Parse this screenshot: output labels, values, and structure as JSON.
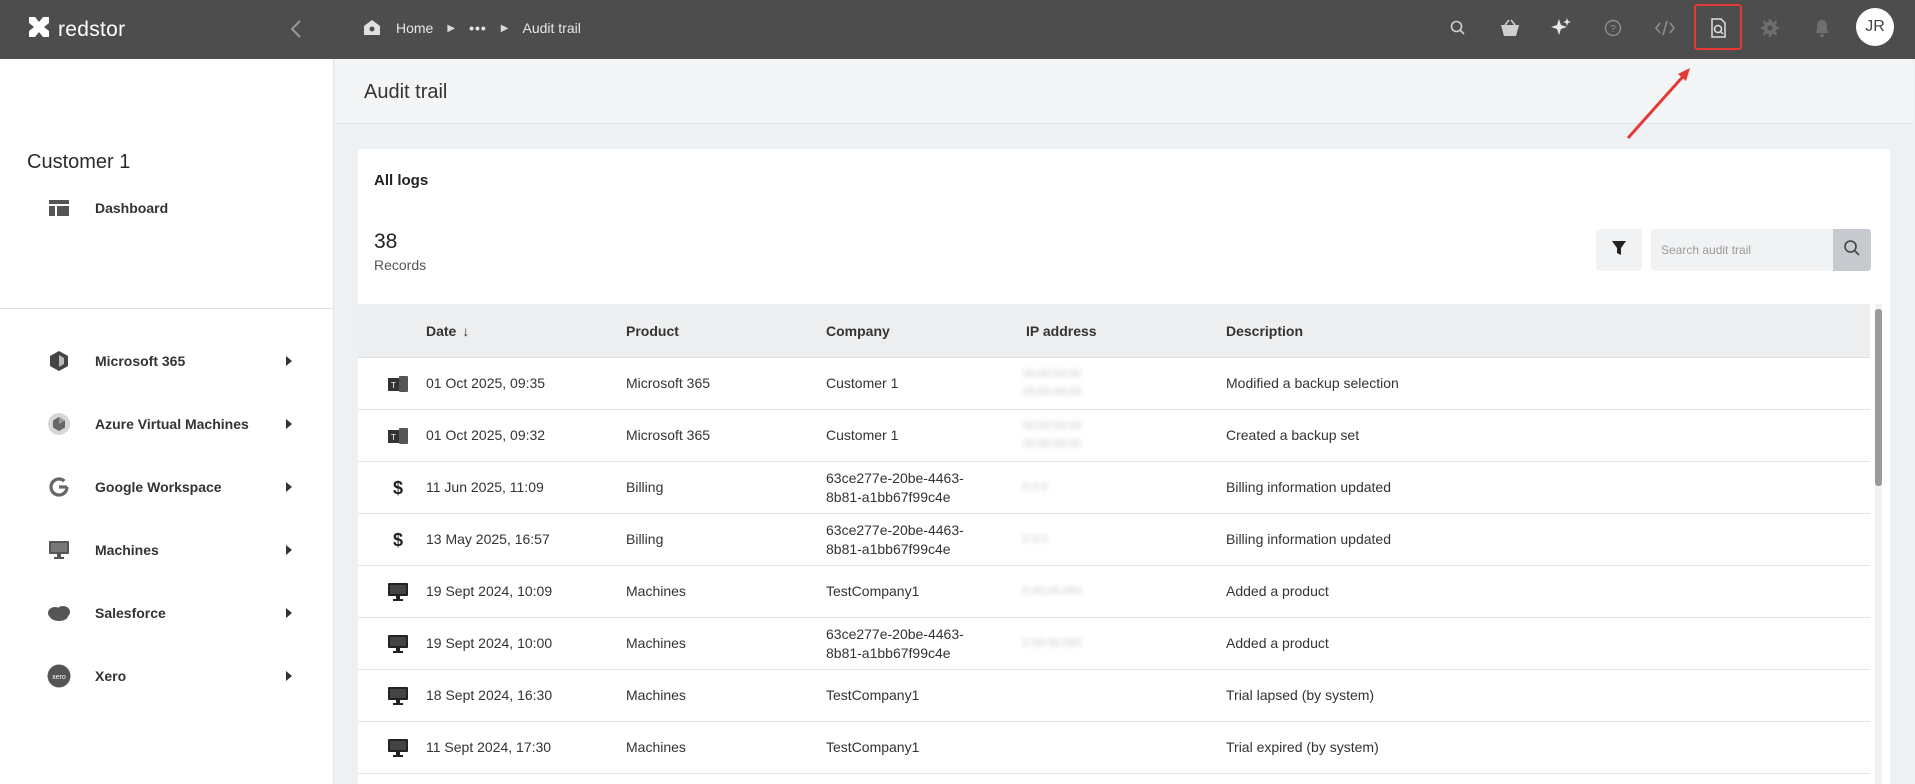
{
  "app": {
    "logo_text": "redstor"
  },
  "breadcrumb": {
    "home": "Home",
    "ellipsis": "•••",
    "current": "Audit trail"
  },
  "topbar_icons": [
    "search-icon",
    "basket-icon",
    "sparkle-icon",
    "help-icon",
    "code-icon",
    "audit-search-icon",
    "gear-icon",
    "bell-icon"
  ],
  "user": {
    "initials": "JR"
  },
  "sidebar": {
    "customer_name": "Customer 1",
    "dashboard": "Dashboard",
    "items": [
      {
        "label": "Microsoft 365",
        "icon": "microsoft-365-icon"
      },
      {
        "label": "Azure Virtual Machines",
        "icon": "azure-icon"
      },
      {
        "label": "Google Workspace",
        "icon": "google-icon"
      },
      {
        "label": "Machines",
        "icon": "monitor-icon"
      },
      {
        "label": "Salesforce",
        "icon": "salesforce-icon"
      },
      {
        "label": "Xero",
        "icon": "xero-icon"
      }
    ]
  },
  "page": {
    "title": "Audit trail"
  },
  "logs": {
    "title": "All logs",
    "count": "38",
    "count_label": "Records",
    "search_placeholder": "Search audit trail",
    "columns": {
      "date": "Date",
      "product": "Product",
      "company": "Company",
      "ip": "IP address",
      "description": "Description"
    },
    "rows": [
      {
        "icon": "microsoft-365-icon",
        "date": "01 Oct 2025, 09:35",
        "product": "Microsoft 365",
        "company": "Customer 1",
        "ip": "00:00:00:00\n00:00:00:00",
        "description": "Modified a backup selection"
      },
      {
        "icon": "microsoft-365-icon",
        "date": "01 Oct 2025, 09:32",
        "product": "Microsoft 365",
        "company": "Customer 1",
        "ip": "00:00:00:00\n00:00:00:00",
        "description": "Created a backup set"
      },
      {
        "icon": "dollar-icon",
        "date": "11 Jun 2025, 11:09",
        "product": "Billing",
        "company": "63ce277e-20be-4463-\n8b81-a1bb67f99c4e",
        "ip": "0.0.0",
        "description": "Billing information updated"
      },
      {
        "icon": "dollar-icon",
        "date": "13 May 2025, 16:57",
        "product": "Billing",
        "company": "63ce277e-20be-4463-\n8b81-a1bb67f99c4e",
        "ip": "0.0.0",
        "description": "Billing information updated"
      },
      {
        "icon": "monitor-icon",
        "date": "19 Sept 2024, 10:09",
        "product": "Machines",
        "company": "TestCompany1",
        "ip": "0.00.00.000",
        "description": "Added a product"
      },
      {
        "icon": "monitor-icon",
        "date": "19 Sept 2024, 10:00",
        "product": "Machines",
        "company": "63ce277e-20be-4463-\n8b81-a1bb67f99c4e",
        "ip": "0.00.00.000",
        "description": "Added a product"
      },
      {
        "icon": "monitor-icon",
        "date": "18 Sept 2024, 16:30",
        "product": "Machines",
        "company": "TestCompany1",
        "ip": "",
        "description": "Trial lapsed (by system)"
      },
      {
        "icon": "monitor-icon",
        "date": "11 Sept 2024, 17:30",
        "product": "Machines",
        "company": "TestCompany1",
        "ip": "",
        "description": "Trial expired (by system)"
      }
    ]
  },
  "colors": {
    "topbar": "#4d4d4d",
    "highlight": "#e53935",
    "annotation_arrow": "#e53935"
  }
}
